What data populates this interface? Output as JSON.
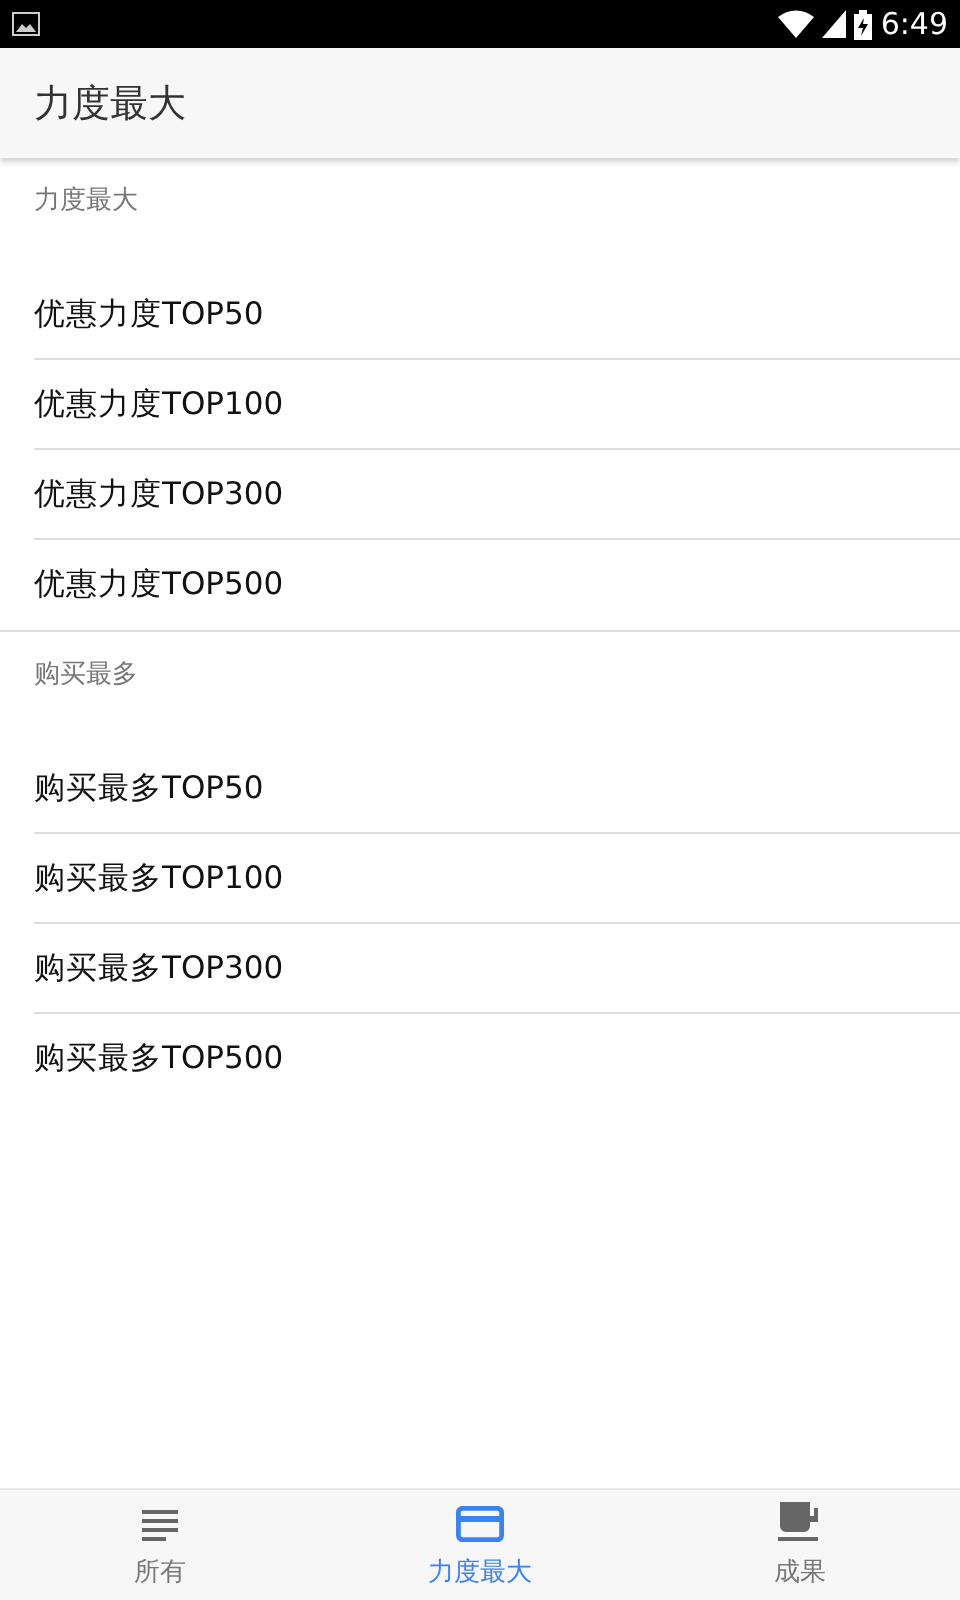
{
  "status_bar": {
    "time": "6:49"
  },
  "app_bar": {
    "title": "力度最大"
  },
  "sections": [
    {
      "header": "力度最大",
      "items": [
        "优惠力度TOP50",
        "优惠力度TOP100",
        "优惠力度TOP300",
        "优惠力度TOP500"
      ]
    },
    {
      "header": "购买最多",
      "items": [
        "购买最多TOP50",
        "购买最多TOP100",
        "购买最多TOP300",
        "购买最多TOP500"
      ]
    }
  ],
  "tabs": [
    {
      "label": "所有",
      "selected": false
    },
    {
      "label": "力度最大",
      "selected": true
    },
    {
      "label": "成果",
      "selected": false
    }
  ]
}
